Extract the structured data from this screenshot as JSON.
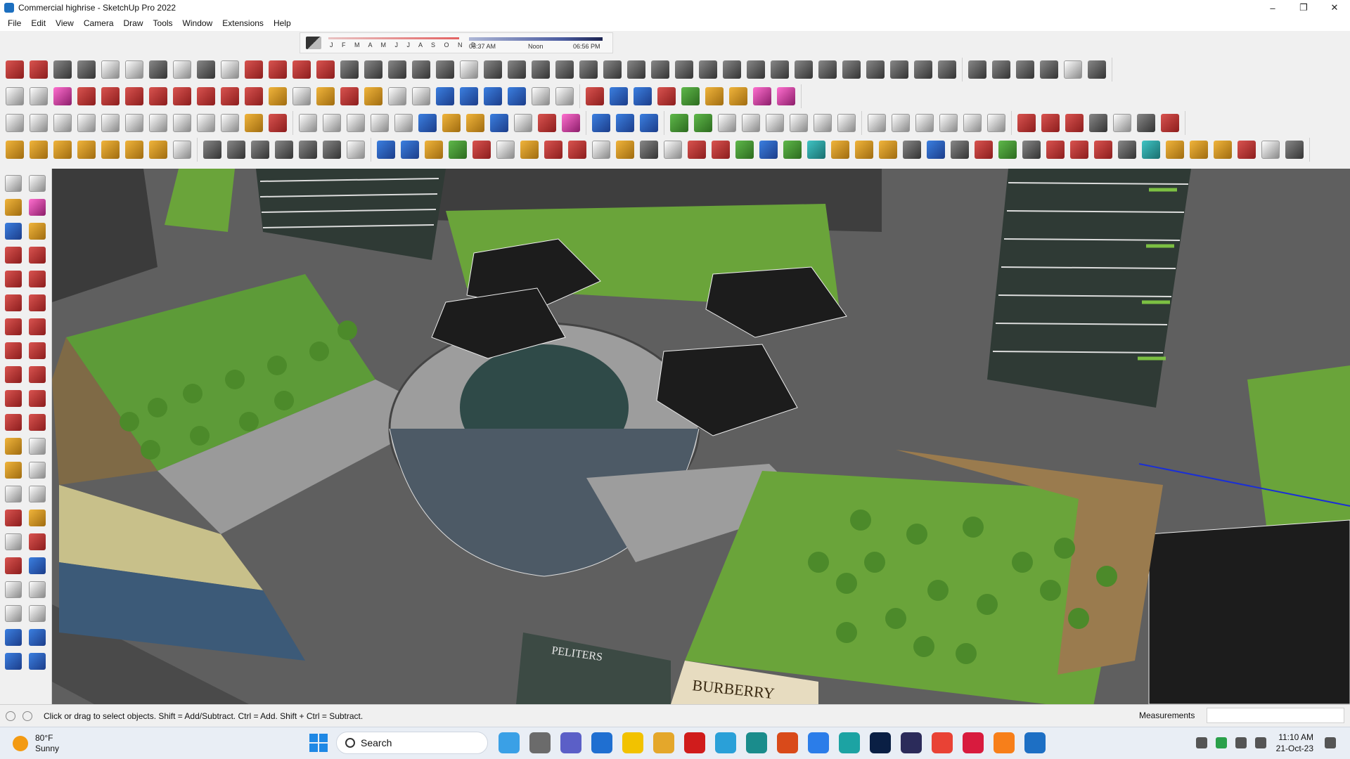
{
  "window": {
    "title": "Commercial highrise - SketchUp Pro 2022",
    "controls": [
      "–",
      "❐",
      "✕"
    ]
  },
  "menu": [
    "File",
    "Edit",
    "View",
    "Camera",
    "Draw",
    "Tools",
    "Window",
    "Extensions",
    "Help"
  ],
  "shadow_settings": {
    "months": "J F M A M J J A S O N D",
    "time_start": "05:37 AM",
    "time_mid": "Noon",
    "time_end": "06:56 PM"
  },
  "statusbar": {
    "hint": "Click or drag to select objects. Shift = Add/Subtract. Ctrl = Add. Shift + Ctrl = Subtract.",
    "measurements_label": "Measurements",
    "measurements_value": ""
  },
  "viewport": {
    "signage": [
      "BURBERRY",
      "PELITERS"
    ]
  },
  "taskbar": {
    "weather_temp": "80°F",
    "weather_desc": "Sunny",
    "search_label": "Search",
    "time": "11:10 AM",
    "date": "21-Oct-23"
  }
}
